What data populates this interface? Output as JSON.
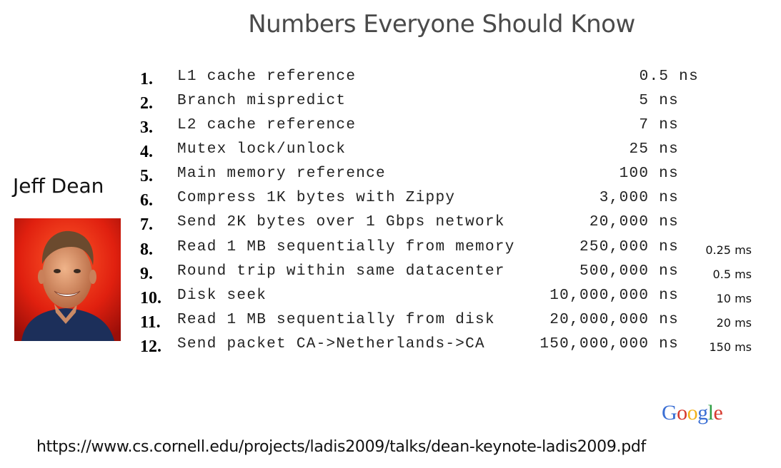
{
  "title": "Numbers Everyone Should Know",
  "speaker": {
    "name": "Jeff Dean"
  },
  "rows": [
    {
      "num": "1.",
      "label": "L1 cache reference",
      "value": "0.5 ns",
      "ms": ""
    },
    {
      "num": "2.",
      "label": "Branch mispredict",
      "value": "5 ns",
      "ms": ""
    },
    {
      "num": "3.",
      "label": "L2 cache reference",
      "value": "7 ns",
      "ms": ""
    },
    {
      "num": "4.",
      "label": "Mutex lock/unlock",
      "value": "25 ns",
      "ms": ""
    },
    {
      "num": "5.",
      "label": "Main memory reference",
      "value": "100 ns",
      "ms": ""
    },
    {
      "num": "6.",
      "label": "Compress 1K bytes with Zippy",
      "value": "3,000 ns",
      "ms": ""
    },
    {
      "num": "7.",
      "label": "Send 2K bytes over 1 Gbps network",
      "value": "20,000 ns",
      "ms": ""
    },
    {
      "num": "8.",
      "label": "Read 1 MB sequentially from memory",
      "value": "250,000 ns",
      "ms": "0.25 ms"
    },
    {
      "num": "9.",
      "label": "Round trip within same datacenter",
      "value": "500,000 ns",
      "ms": "0.5 ms"
    },
    {
      "num": "10.",
      "label": "Disk seek",
      "value": "10,000,000 ns",
      "ms": "10 ms"
    },
    {
      "num": "11.",
      "label": "Read 1 MB sequentially from disk",
      "value": "20,000,000 ns",
      "ms": "20 ms"
    },
    {
      "num": "12.",
      "label": "Send packet CA->Netherlands->CA",
      "value": "150,000,000 ns",
      "ms": "150 ms"
    }
  ],
  "logo": {
    "letters": [
      "G",
      "o",
      "o",
      "g",
      "l",
      "e"
    ],
    "colors": [
      "#3b6fd4",
      "#d63a2f",
      "#f2b21c",
      "#3b6fd4",
      "#2f9e44",
      "#d63a2f"
    ]
  },
  "footer": {
    "url": "https://www.cs.cornell.edu/projects/ladis2009/talks/dean-keynote-ladis2009.pdf"
  },
  "colors": {
    "title": "#4a4a4a",
    "photo_background": "#e8261a"
  }
}
